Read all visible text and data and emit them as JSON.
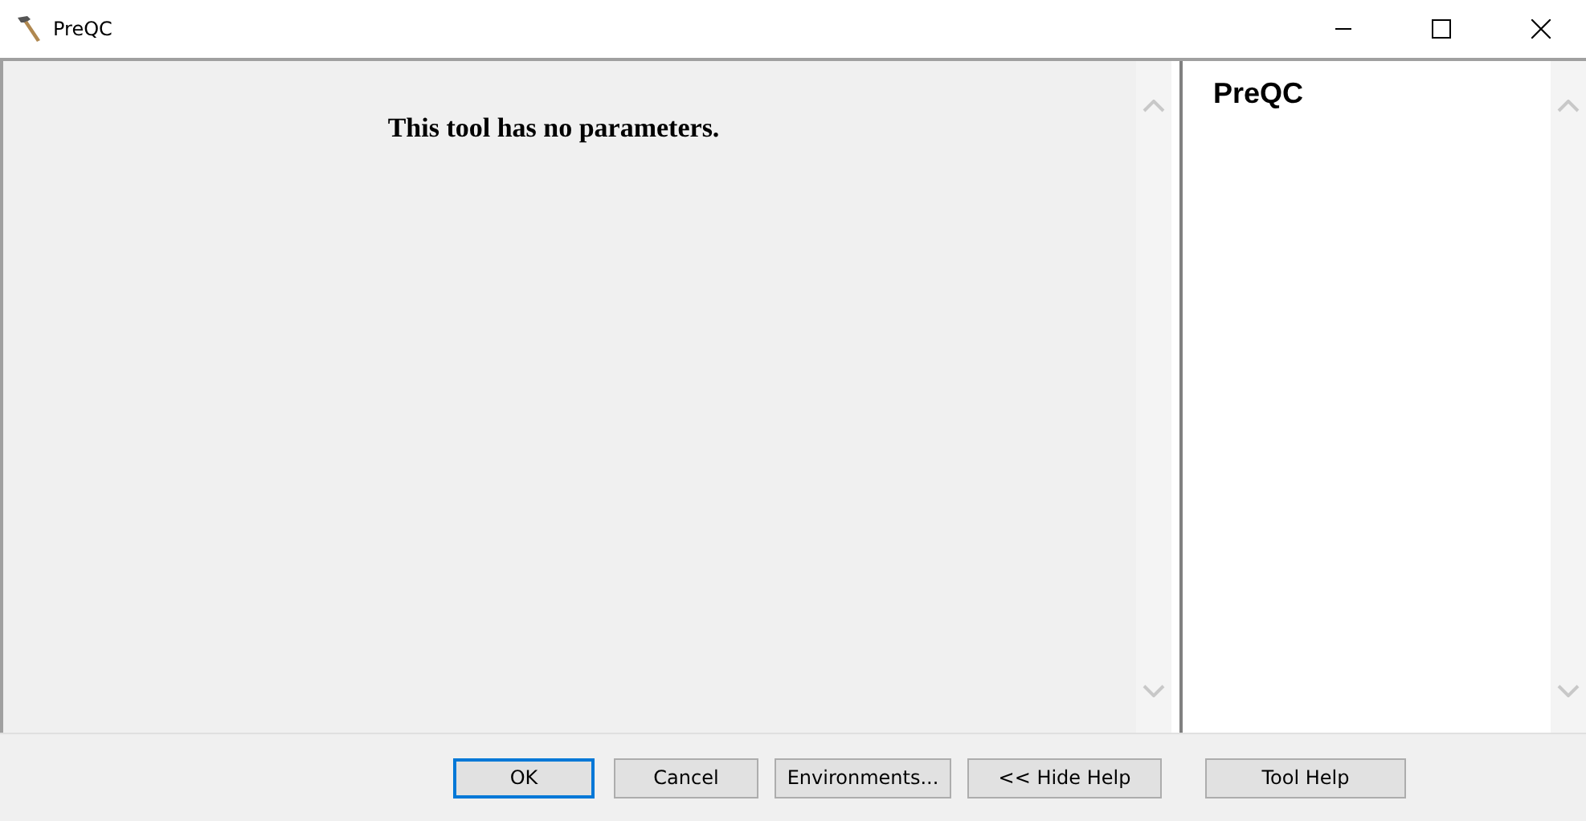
{
  "window": {
    "title": "PreQC"
  },
  "parameters_panel": {
    "message": "This tool has no parameters."
  },
  "help_panel": {
    "title": "PreQC"
  },
  "buttons": [
    {
      "label": "OK",
      "default": true
    },
    {
      "label": "Cancel",
      "default": false
    },
    {
      "label": "Environments...",
      "default": false
    },
    {
      "label": "<< Hide Help",
      "default": false
    },
    {
      "label": "Tool Help",
      "default": false
    }
  ]
}
